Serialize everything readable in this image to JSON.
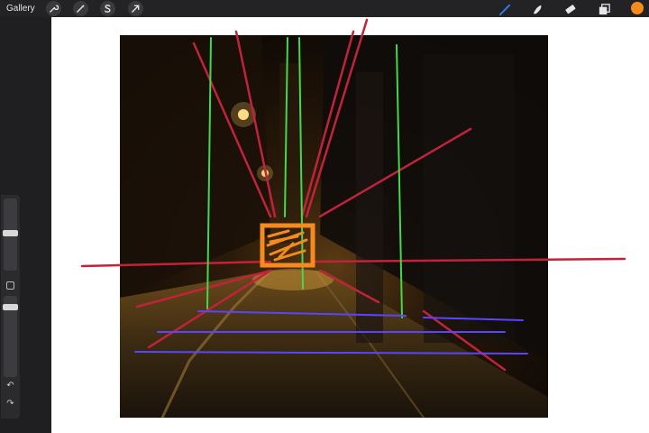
{
  "topbar": {
    "gallery_label": "Gallery",
    "left_tools": [
      "wrench-icon",
      "magic-wand-icon",
      "selection-icon",
      "transform-arrow-icon"
    ],
    "right_tools": [
      "brush-icon",
      "smudge-icon",
      "eraser-icon",
      "layers-icon"
    ],
    "active_color": "#f58a1f",
    "brush_active_color": "#2d7ff0"
  },
  "sidebar": {
    "brush_size_level": 0.6,
    "opacity_level": 0.95,
    "icons": [
      "modify-button-icon",
      "undo-icon",
      "redo-icon"
    ]
  },
  "canvas": {
    "background": "#ffffff",
    "image_subject": "night-alley-photo",
    "guide_colors": {
      "perspective": "#c0233a",
      "vertical": "#44d94a",
      "horizontal": "#5a45ff",
      "focal_box": "#f58a1f"
    }
  }
}
